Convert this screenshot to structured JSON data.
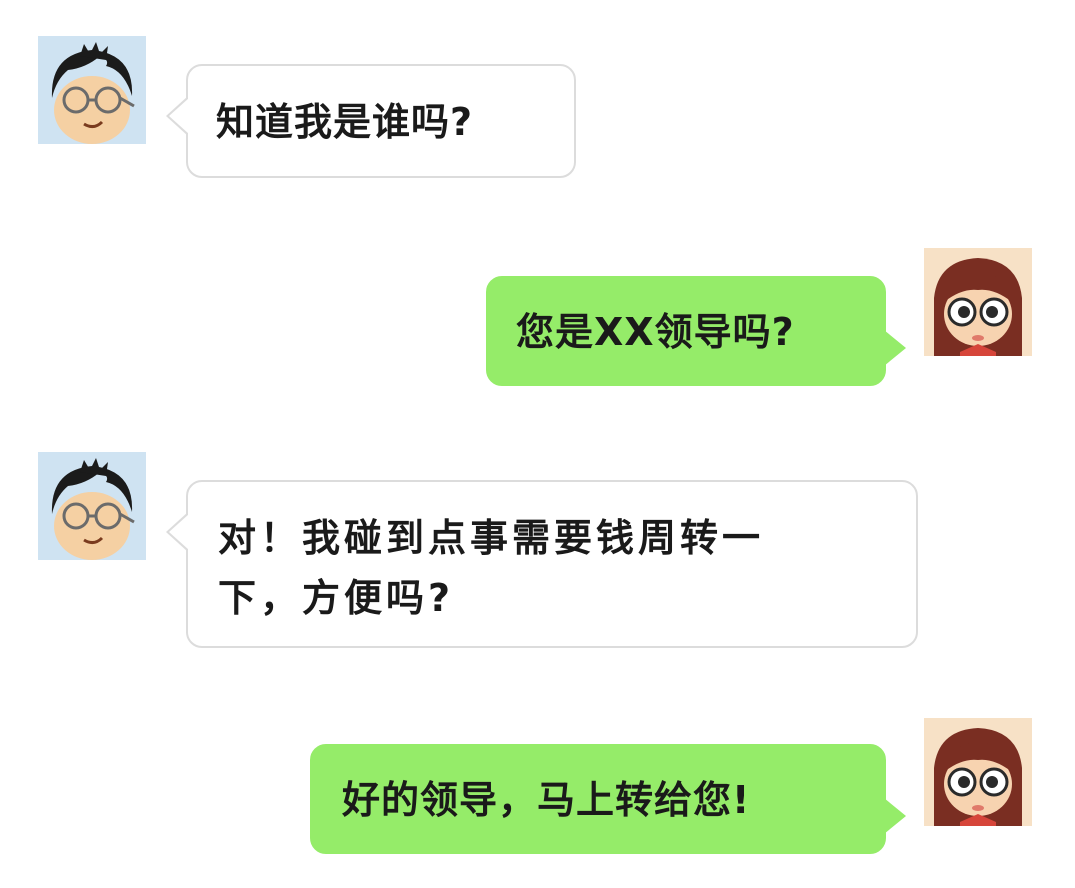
{
  "conversation": {
    "messages": [
      {
        "sender": "male",
        "side": "left",
        "text": "知道我是谁吗?"
      },
      {
        "sender": "female",
        "side": "right",
        "text": "您是XX领导吗?"
      },
      {
        "sender": "male",
        "side": "left",
        "text": "对！我碰到点事需要钱周转一\n下，方便吗?"
      },
      {
        "sender": "female",
        "side": "right",
        "text": "好的领导，马上转给您!"
      }
    ]
  },
  "avatars": {
    "male": {
      "icon": "cartoon-boy-with-glasses-icon",
      "background": "#cfe3f2"
    },
    "female": {
      "icon": "cartoon-girl-with-glasses-icon",
      "background": "#f7e1c6"
    }
  },
  "colors": {
    "incoming_bubble": "#ffffff",
    "incoming_border": "#dcdcdc",
    "outgoing_bubble": "#95ec69",
    "text": "#1a1a1a",
    "page_background": "#ffffff"
  }
}
